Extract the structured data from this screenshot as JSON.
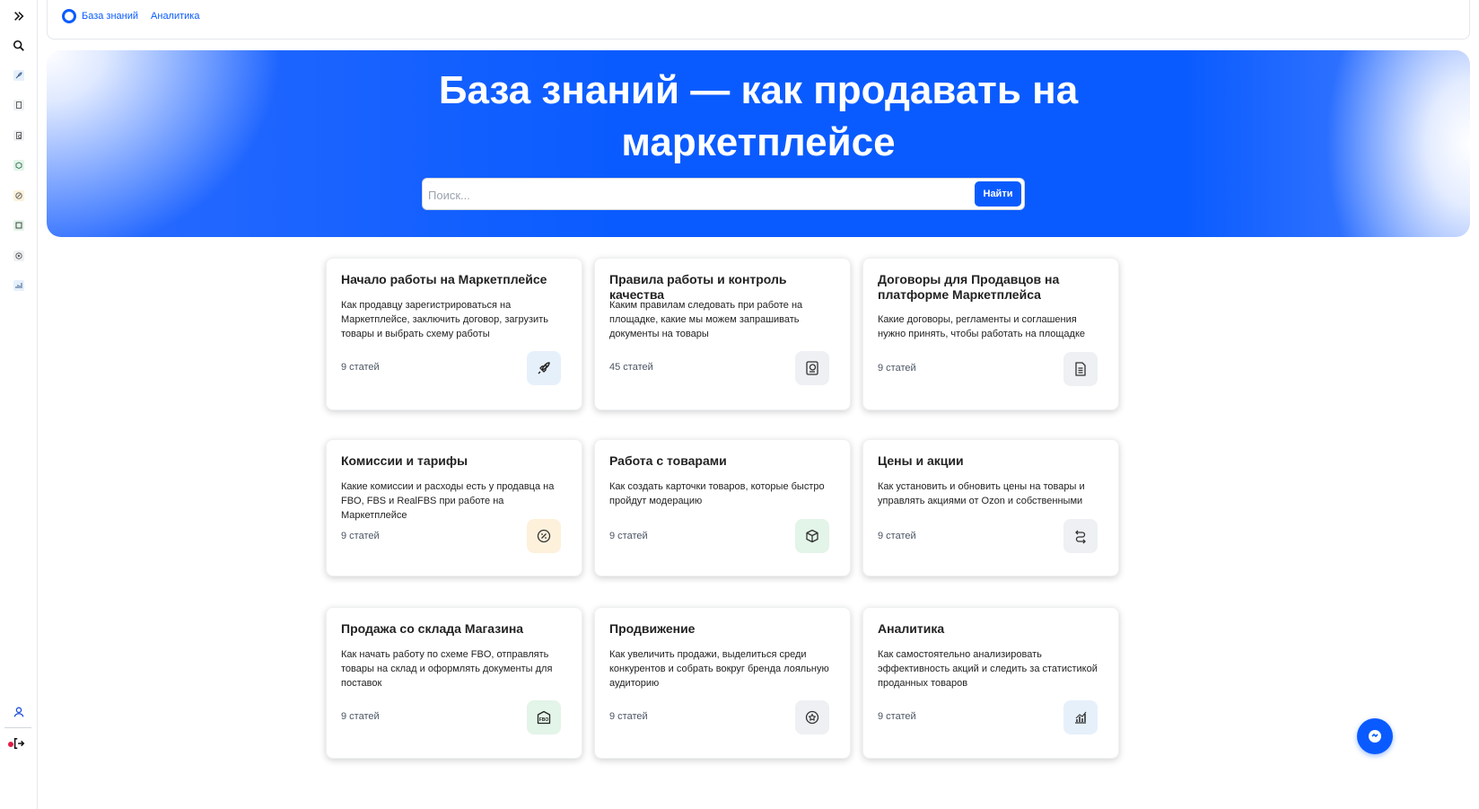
{
  "sidebar": {
    "items": [
      {
        "icon": "chevrons-right-icon"
      },
      {
        "icon": "search-icon"
      },
      {
        "icon": "rocket-icon"
      },
      {
        "icon": "document-icon"
      },
      {
        "icon": "document-check-icon"
      },
      {
        "icon": "box-icon"
      },
      {
        "icon": "percent-icon"
      },
      {
        "icon": "warehouse-icon"
      },
      {
        "icon": "target-icon"
      },
      {
        "icon": "chart-icon"
      }
    ],
    "bottom": [
      {
        "icon": "user-icon"
      },
      {
        "icon": "logout-icon"
      }
    ]
  },
  "breadcrumb": {
    "items": [
      "База знаний",
      "Аналитика"
    ]
  },
  "hero": {
    "title_line1": "База знаний — как продавать на",
    "title_line2": "маркетплейсе",
    "search_placeholder": "Поиск...",
    "search_button": "Найти"
  },
  "cards": [
    {
      "title": "Начало работы на Маркетплейсе",
      "desc": "Как продавцу зарегистрироваться на Маркетплейсе, заключить договор, загрузить товары и выбрать схему работы",
      "count": "9 статей",
      "icon": "rocket-icon",
      "icon_bg": "#e6f0fb"
    },
    {
      "title": "Правила работы и контроль качества",
      "desc": "Каким правилам следовать при работе на площадке, какие мы можем запрашивать документы на товары",
      "count": "45 статей",
      "icon": "passport-icon",
      "icon_bg": "#eef0f3"
    },
    {
      "title": "Договоры для Продавцов на платформе Маркетплейса",
      "desc": "Какие договоры, регламенты и соглашения нужно принять, чтобы работать на площадке",
      "count": "9 статей",
      "icon": "document-icon",
      "icon_bg": "#eef0f3"
    },
    {
      "title": "Комиссии и тарифы",
      "desc": "Какие комиссии и расходы есть у продавца на FBO, FBS и RealFBS при работе на Маркетплейсе",
      "count": "9 статей",
      "icon": "percent-icon",
      "icon_bg": "#fdf1dc"
    },
    {
      "title": "Работа с товарами",
      "desc": "Как создать карточки товаров, которые быстро пройдут модерацию",
      "count": "9 статей",
      "icon": "box-icon",
      "icon_bg": "#e3f4e8"
    },
    {
      "title": "Цены и акции",
      "desc": "Как установить и обновить цены на товары и управлять акциями от Ozon и собственными",
      "count": "9 статей",
      "icon": "route-icon",
      "icon_bg": "#eef0f3"
    },
    {
      "title": "Продажа со склада Магазина",
      "desc": "Как начать работу по схеме FBO, отправлять товары на склад и оформлять документы для поставок",
      "count": "9 статей",
      "icon": "fbo-icon",
      "icon_bg": "#e3f4e8"
    },
    {
      "title": "Продвижение",
      "desc": "Как увеличить продажи, выделиться среди конкурентов и собрать вокруг бренда лояльную аудиторию",
      "count": "9 статей",
      "icon": "badge-icon",
      "icon_bg": "#eef0f3"
    },
    {
      "title": "Аналитика",
      "desc": "Как самостоятельно анализировать эффективность акций и следить за статистикой проданных товаров",
      "count": "9 статей",
      "icon": "chart-icon",
      "icon_bg": "#e6f0fb"
    }
  ],
  "fab": {
    "icon": "chat-icon"
  }
}
